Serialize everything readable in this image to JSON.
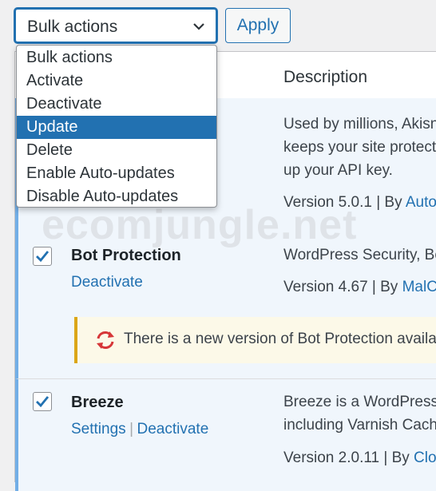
{
  "toolbar": {
    "bulk_value": "Bulk actions",
    "apply_label": "Apply"
  },
  "dropdown": {
    "options": [
      "Bulk actions",
      "Activate",
      "Deactivate",
      "Update",
      "Delete",
      "Enable Auto-updates",
      "Disable Auto-updates"
    ],
    "selected": "Update"
  },
  "table": {
    "column_description": "Description"
  },
  "plugins": [
    {
      "name": "",
      "checked": true,
      "desc_lines": [
        "Used by millions, Akisn",
        "keeps your site protect",
        "up your API key."
      ],
      "version": "Version 5.0.1",
      "by": "| By",
      "author": "Auto"
    },
    {
      "name": "Bot Protection",
      "checked": true,
      "action": "Deactivate",
      "desc_lines": [
        "WordPress Security, Bo"
      ],
      "version": "Version 4.67",
      "by": "| By",
      "author": "MalCa",
      "notice": "There is a new version of Bot Protection availa"
    },
    {
      "name": "Breeze",
      "checked": true,
      "actions": [
        "Settings",
        "Deactivate"
      ],
      "separator": "|",
      "desc_lines": [
        "Breeze is a WordPress",
        "including Varnish Cach"
      ],
      "version": "Version 2.0.11",
      "by": "| By",
      "author": "Clou"
    }
  ],
  "watermark": "ecomjungle.net",
  "colors": {
    "accent": "#2271b1",
    "active_row_bg": "#f0f6fc",
    "active_row_border": "#72aee6",
    "notice_border": "#dba617",
    "update_icon": "#d63638"
  }
}
